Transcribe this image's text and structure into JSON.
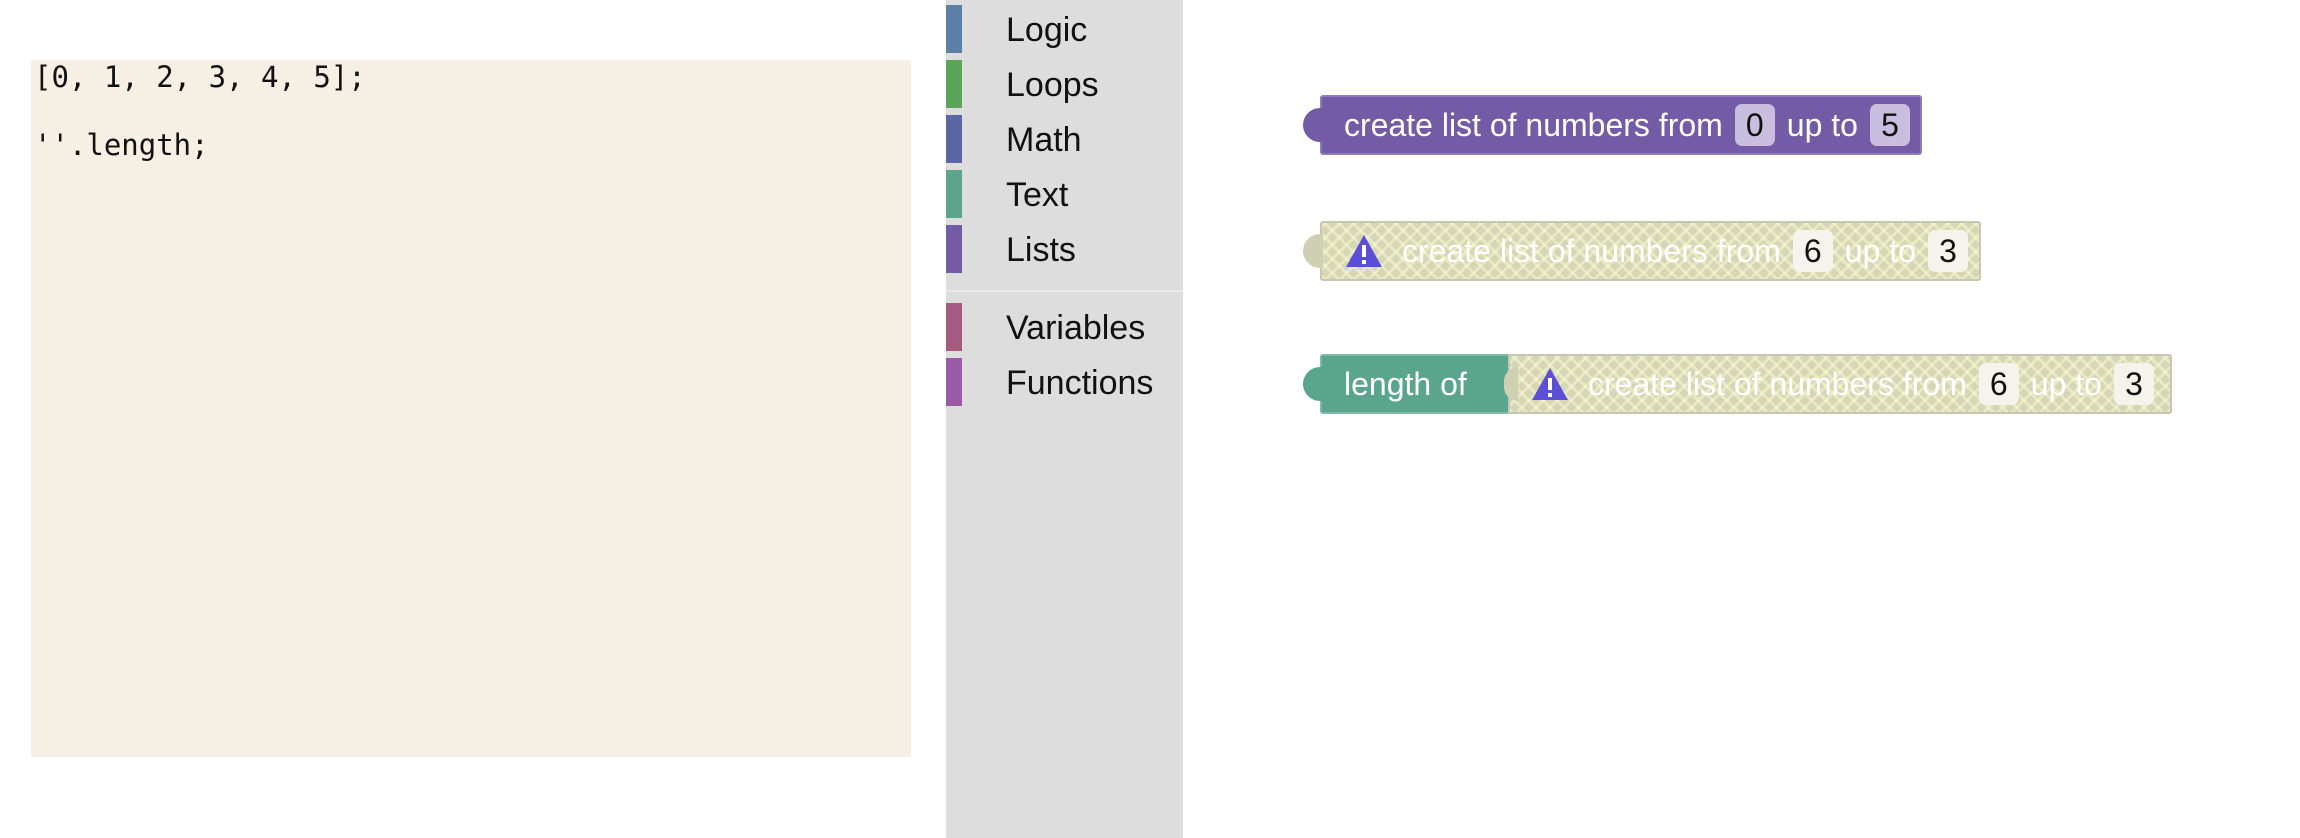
{
  "code": {
    "lines": [
      "[0, 1, 2, 3, 4, 5];",
      "''.length;"
    ]
  },
  "toolbox": {
    "categories": [
      {
        "label": "Logic",
        "color": "#5b80a5"
      },
      {
        "label": "Loops",
        "color": "#5ba55b"
      },
      {
        "label": "Math",
        "color": "#5b67a5"
      },
      {
        "label": "Text",
        "color": "#5ba58c"
      },
      {
        "label": "Lists",
        "color": "#745ba5"
      },
      {
        "label": "Variables",
        "color": "#a55b80"
      },
      {
        "label": "Functions",
        "color": "#995ba5"
      }
    ]
  },
  "workspace": {
    "block1": {
      "text_from": "create list of numbers from",
      "from_value": "0",
      "text_upto": "up to",
      "to_value": "5"
    },
    "block2": {
      "text_from": "create list of numbers from",
      "from_value": "6",
      "text_upto": "up to",
      "to_value": "3"
    },
    "block3": {
      "label": "length of",
      "inner": {
        "text_from": "create list of numbers from",
        "from_value": "6",
        "text_upto": "up to",
        "to_value": "3"
      }
    }
  }
}
